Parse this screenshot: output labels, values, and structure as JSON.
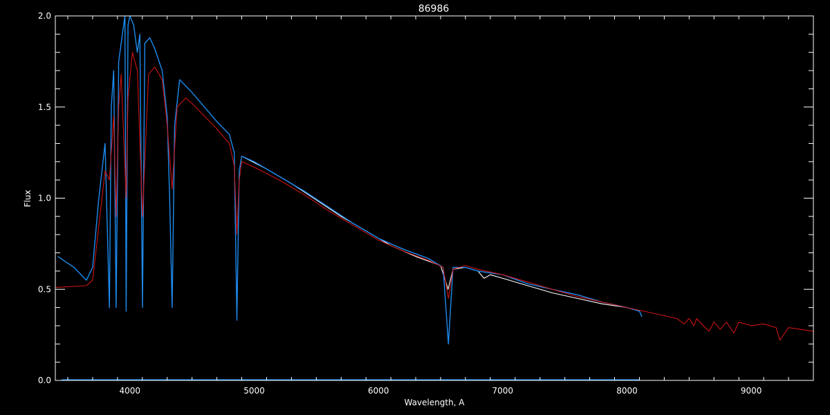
{
  "chart_data": {
    "type": "line",
    "title": "86986",
    "xlabel": "Wavelength, A",
    "ylabel": "Flux",
    "xlim": [
      3400,
      9500
    ],
    "ylim": [
      0,
      2.0
    ],
    "x_ticks": [
      4000,
      5000,
      6000,
      7000,
      8000,
      9000
    ],
    "x_tick_labels": [
      "4000",
      "5000",
      "6000",
      "7000",
      "8000",
      "9000"
    ],
    "y_ticks": [
      0,
      0.5,
      1.0,
      1.5,
      2.0
    ],
    "y_tick_labels": [
      "0.0",
      "0.5",
      "1.0",
      "1.5",
      "2.0"
    ],
    "grid": false,
    "colors": {
      "background": "#000000",
      "axes": "#ffffff",
      "white_series": "#ffffff",
      "blue_series": "#1e8cf0",
      "red_series": "#cc1414"
    },
    "series": [
      {
        "color": "white",
        "x": [
          4900,
          5100,
          5300,
          5500,
          5700,
          5900,
          6100,
          6300,
          6500,
          6560,
          6600,
          6700,
          6800,
          6850,
          6900,
          7000,
          7200,
          7400,
          7600,
          7800,
          8000,
          8100
        ],
        "y": [
          1.23,
          1.16,
          1.08,
          0.99,
          0.9,
          0.82,
          0.74,
          0.68,
          0.63,
          0.5,
          0.61,
          0.62,
          0.6,
          0.56,
          0.58,
          0.56,
          0.52,
          0.48,
          0.45,
          0.42,
          0.4,
          0.38
        ]
      },
      {
        "color": "blue",
        "x": [
          3420,
          3550,
          3650,
          3700,
          3750,
          3800,
          3835,
          3850,
          3870,
          3889,
          3910,
          3930,
          3960,
          3970,
          3985,
          4000,
          4030,
          4060,
          4080,
          4101,
          4120,
          4160,
          4200,
          4260,
          4300,
          4320,
          4340,
          4360,
          4400,
          4500,
          4600,
          4700,
          4800,
          4840,
          4861,
          4880,
          4900,
          5000,
          5200,
          5400,
          5600,
          5800,
          6000,
          6200,
          6400,
          6520,
          6563,
          6600,
          6700,
          6800,
          7000,
          7200,
          7400,
          7600,
          7800,
          8000,
          8100,
          8120
        ],
        "y": [
          0.68,
          0.62,
          0.55,
          0.62,
          1.0,
          1.3,
          0.4,
          1.5,
          1.7,
          0.4,
          1.75,
          1.85,
          2.0,
          0.38,
          1.95,
          2.0,
          1.95,
          1.8,
          1.9,
          0.4,
          1.85,
          1.88,
          1.82,
          1.7,
          1.45,
          1.0,
          0.4,
          1.4,
          1.65,
          1.58,
          1.5,
          1.42,
          1.35,
          1.25,
          0.33,
          1.15,
          1.23,
          1.2,
          1.12,
          1.04,
          0.95,
          0.86,
          0.78,
          0.72,
          0.67,
          0.62,
          0.2,
          0.62,
          0.62,
          0.6,
          0.58,
          0.53,
          0.5,
          0.47,
          0.43,
          0.4,
          0.38,
          0.35
        ]
      },
      {
        "color": "red",
        "x": [
          3400,
          3650,
          3700,
          3750,
          3800,
          3835,
          3870,
          3889,
          3910,
          3930,
          3970,
          3985,
          4020,
          4060,
          4101,
          4150,
          4200,
          4260,
          4300,
          4340,
          4380,
          4450,
          4500,
          4600,
          4700,
          4800,
          4840,
          4861,
          4880,
          4900,
          5000,
          5200,
          5400,
          5600,
          5800,
          6000,
          6200,
          6400,
          6520,
          6563,
          6600,
          6700,
          6800,
          7000,
          7200,
          7400,
          7600,
          7800,
          8000,
          8200,
          8400,
          8460,
          8500,
          8540,
          8560,
          8600,
          8660,
          8700,
          8750,
          8800,
          8860,
          8900,
          9000,
          9100,
          9200,
          9230,
          9300,
          9500
        ],
        "y": [
          0.51,
          0.52,
          0.55,
          0.85,
          1.15,
          1.1,
          1.45,
          0.9,
          1.5,
          1.68,
          1.0,
          1.55,
          1.8,
          1.7,
          0.9,
          1.68,
          1.72,
          1.65,
          1.4,
          1.05,
          1.5,
          1.55,
          1.52,
          1.45,
          1.38,
          1.3,
          1.18,
          0.8,
          1.1,
          1.2,
          1.17,
          1.1,
          1.02,
          0.93,
          0.85,
          0.77,
          0.71,
          0.66,
          0.62,
          0.45,
          0.61,
          0.63,
          0.61,
          0.58,
          0.54,
          0.5,
          0.46,
          0.43,
          0.4,
          0.37,
          0.34,
          0.31,
          0.34,
          0.3,
          0.34,
          0.31,
          0.27,
          0.32,
          0.28,
          0.32,
          0.26,
          0.32,
          0.3,
          0.31,
          0.29,
          0.22,
          0.29,
          0.27
        ]
      }
    ],
    "baseline": {
      "x_range": [
        3450,
        8100
      ],
      "y": 0.0
    }
  }
}
